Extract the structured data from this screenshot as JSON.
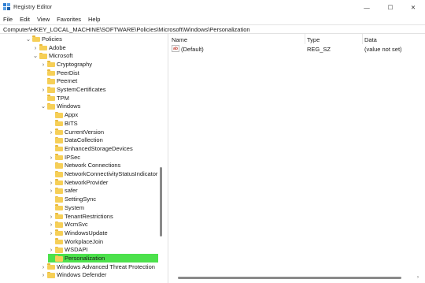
{
  "window": {
    "title": "Registry Editor",
    "controls": {
      "minimize": "—",
      "maximize": "☐",
      "close": "✕"
    }
  },
  "menu": [
    "File",
    "Edit",
    "View",
    "Favorites",
    "Help"
  ],
  "address": "Computer\\HKEY_LOCAL_MACHINE\\SOFTWARE\\Policies\\Microsoft\\Windows\\Personalization",
  "tree": [
    {
      "label": "Policies",
      "chev": "⌄"
    },
    {
      "label": "Adobe",
      "chev": "›"
    },
    {
      "label": "Microsoft",
      "chev": "⌄"
    },
    {
      "label": "Cryptography",
      "chev": "›"
    },
    {
      "label": "PeerDist",
      "chev": ""
    },
    {
      "label": "Peernet",
      "chev": ""
    },
    {
      "label": "SystemCertificates",
      "chev": "›"
    },
    {
      "label": "TPM",
      "chev": ""
    },
    {
      "label": "Windows",
      "chev": "⌄"
    },
    {
      "label": "Appx",
      "chev": ""
    },
    {
      "label": "BITS",
      "chev": ""
    },
    {
      "label": "CurrentVersion",
      "chev": "›"
    },
    {
      "label": "DataCollection",
      "chev": ""
    },
    {
      "label": "EnhancedStorageDevices",
      "chev": ""
    },
    {
      "label": "IPSec",
      "chev": "›"
    },
    {
      "label": "Network Connections",
      "chev": ""
    },
    {
      "label": "NetworkConnectivityStatusIndicator",
      "chev": ""
    },
    {
      "label": "NetworkProvider",
      "chev": "›"
    },
    {
      "label": "safer",
      "chev": "›"
    },
    {
      "label": "SettingSync",
      "chev": ""
    },
    {
      "label": "System",
      "chev": ""
    },
    {
      "label": "TenantRestrictions",
      "chev": "›"
    },
    {
      "label": "WcmSvc",
      "chev": "›"
    },
    {
      "label": "WindowsUpdate",
      "chev": "›"
    },
    {
      "label": "WorkplaceJoin",
      "chev": ""
    },
    {
      "label": "WSDAPI",
      "chev": "›"
    },
    {
      "label": "Personalization",
      "chev": "",
      "selected": true
    },
    {
      "label": "Windows Advanced Threat Protection",
      "chev": "›"
    },
    {
      "label": "Windows Defender",
      "chev": "›"
    }
  ],
  "list": {
    "columns": {
      "name": "Name",
      "type": "Type",
      "data": "Data"
    },
    "rows": [
      {
        "icon": "ab",
        "name": "(Default)",
        "type": "REG_SZ",
        "data": "(value not set)"
      }
    ]
  }
}
